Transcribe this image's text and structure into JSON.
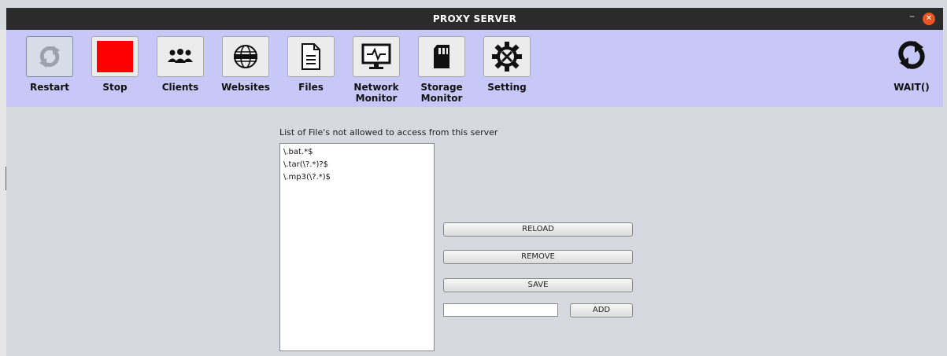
{
  "window": {
    "title": "PROXY SERVER",
    "minimize_symbol": "–",
    "close_symbol": "✕",
    "close_color": "#e95420"
  },
  "toolbar": {
    "background": "#c8c8f8",
    "items": [
      {
        "label": "Restart",
        "icon": "restart-icon"
      },
      {
        "label": "Stop",
        "icon": "stop-icon"
      },
      {
        "label": "Clients",
        "icon": "clients-icon"
      },
      {
        "label": "Websites",
        "icon": "globe-icon"
      },
      {
        "label": "Files",
        "icon": "file-icon"
      },
      {
        "label": "Network Monitor",
        "icon": "network-monitor-icon"
      },
      {
        "label": "Storage Monitor",
        "icon": "sd-card-icon"
      },
      {
        "label": "Setting",
        "icon": "settings-gear-icon"
      }
    ],
    "status": {
      "label": "WAIT()",
      "icon": "refresh-icon"
    }
  },
  "files_panel": {
    "list_label": "List of File's not allowed to access from this server",
    "entries": [
      "\\.bat.*$",
      "\\.tar(\\?.*)?$",
      "\\.mp3(\\?.*)$"
    ],
    "buttons": {
      "reload": "RELOAD",
      "remove": "REMOVE",
      "save": "SAVE",
      "add": "ADD"
    },
    "new_entry": {
      "value": "",
      "placeholder": ""
    }
  },
  "colors": {
    "stop_red": "#ff0000",
    "window_bg": "#d6d9e0"
  }
}
